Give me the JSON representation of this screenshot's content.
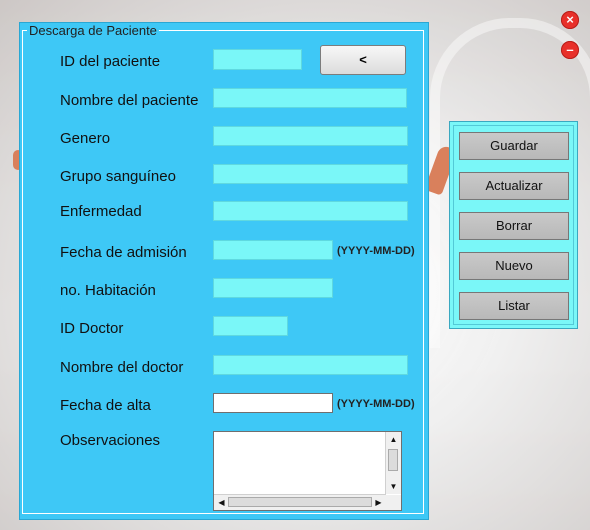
{
  "window": {
    "close_symbol": "×",
    "minimize_symbol": "–"
  },
  "panel": {
    "title": "Descarga de Paciente"
  },
  "form": {
    "back_button": "<",
    "patient_id": {
      "label": "ID del paciente",
      "value": ""
    },
    "patient_name": {
      "label": "Nombre del paciente",
      "value": ""
    },
    "gender": {
      "label": "Genero",
      "value": ""
    },
    "blood_group": {
      "label": "Grupo sanguíneo",
      "value": ""
    },
    "disease": {
      "label": "Enfermedad",
      "value": ""
    },
    "admission_date": {
      "label": "Fecha de admisión",
      "value": "",
      "format": "(YYYY-MM-DD)"
    },
    "room_no": {
      "label": "no. Habitación",
      "value": ""
    },
    "doctor_id": {
      "label": "ID Doctor",
      "value": ""
    },
    "doctor_name": {
      "label": "Nombre del doctor",
      "value": ""
    },
    "discharge_date": {
      "label": "Fecha de alta",
      "value": "",
      "format": "(YYYY-MM-DD)"
    },
    "remarks": {
      "label": "Observaciones",
      "value": ""
    }
  },
  "actions": {
    "save": "Guardar",
    "update": "Actualizar",
    "delete": "Borrar",
    "new": "Nuevo",
    "list": "Listar"
  },
  "icons": {
    "close": "close-icon",
    "minimize": "minimize-icon"
  },
  "colors": {
    "panel_bg": "#3ec8f6",
    "field_bg": "#7af7f8",
    "close_button": "#e8302a"
  }
}
